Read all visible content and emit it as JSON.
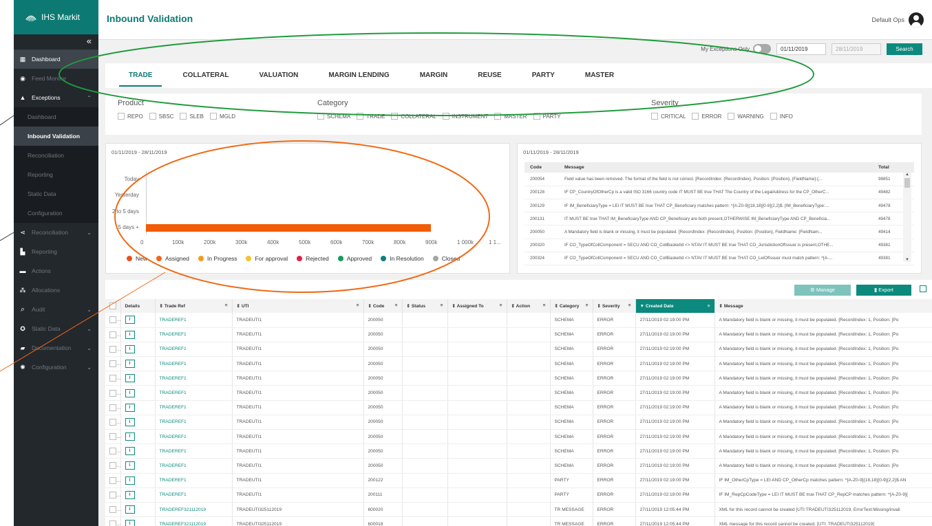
{
  "brand": {
    "name": "IHS Markit"
  },
  "sidebar": {
    "collapse": "«",
    "items": [
      {
        "label": "Dashboard",
        "icon": "dashboard-icon"
      },
      {
        "label": "Feed Monitor",
        "icon": "eye-icon"
      },
      {
        "label": "Exceptions",
        "icon": "warning-icon"
      },
      {
        "label": "Reconciliation",
        "icon": "share-icon"
      },
      {
        "label": "Reporting",
        "icon": "chart-icon"
      },
      {
        "label": "Actions",
        "icon": "briefcase-icon"
      },
      {
        "label": "Allocations",
        "icon": "sitemap-icon"
      },
      {
        "label": "Audit",
        "icon": "search-icon"
      },
      {
        "label": "Static Data",
        "icon": "cog-icon"
      },
      {
        "label": "Documentation",
        "icon": "folder-icon"
      },
      {
        "label": "Configuration",
        "icon": "gear-icon"
      }
    ],
    "exceptions_sub": [
      "Dashboard",
      "Inbound Validation",
      "Reconciliation",
      "Reporting",
      "Static Data",
      "Configuration"
    ]
  },
  "header": {
    "title": "Inbound Validation",
    "user": "Default Ops"
  },
  "filters": {
    "exceptions_only": "My Exceptions Only",
    "date_from": "01/11/2019",
    "date_to": "28/11/2019",
    "search": "Search"
  },
  "tabs": [
    "TRADE",
    "COLLATERAL",
    "VALUATION",
    "MARGIN LENDING",
    "MARGIN",
    "REUSE",
    "PARTY",
    "MASTER"
  ],
  "filter_panel": {
    "product": {
      "label": "Product",
      "options": [
        "REPO",
        "SBSC",
        "SLEB",
        "MGLD"
      ]
    },
    "category": {
      "label": "Category",
      "options": [
        "SCHEMA",
        "TRADE",
        "COLLATERAL",
        "INSTRUMENT",
        "MASTER",
        "PARTY"
      ]
    },
    "severity": {
      "label": "Severity",
      "options": [
        "CRITICAL",
        "ERROR",
        "WARNING",
        "INFO"
      ]
    }
  },
  "age_chart": {
    "range": "01/11/2019 - 28/11/2019"
  },
  "chart_data": {
    "type": "bar",
    "orientation": "horizontal",
    "categories": [
      "Today",
      "Yesterday",
      "2 to 5 days",
      "5 days +"
    ],
    "series": [
      {
        "name": "Assigned",
        "values": [
          0,
          0,
          0,
          900000
        ]
      }
    ],
    "xticks": [
      "0",
      "100k",
      "200k",
      "300k",
      "400k",
      "500k",
      "600k",
      "700k",
      "800k",
      "900k",
      "1 000k",
      "1 1..."
    ],
    "xlim": [
      0,
      1100000
    ],
    "legend": [
      {
        "name": "New",
        "color": "#e9501e"
      },
      {
        "name": "Assigned",
        "color": "#f0661a"
      },
      {
        "name": "In Progress",
        "color": "#f39a1e"
      },
      {
        "name": "For approval",
        "color": "#f6c02e"
      },
      {
        "name": "Rejected",
        "color": "#e21f4b"
      },
      {
        "name": "Approved",
        "color": "#1a9a58"
      },
      {
        "name": "In Resolution",
        "color": "#0d7f80"
      },
      {
        "name": "Closed",
        "color": "#a5a5a5"
      }
    ],
    "legend_position": "bottom",
    "bar_color": "#f25c05"
  },
  "messages": {
    "range": "01/11/2019 - 28/11/2019",
    "headers": [
      "Code",
      "Message",
      "Total"
    ],
    "rows": [
      [
        "200054",
        "Field value has been removed. The format of the field is not correct. [RecordIndex: {RecordIndex}, Position: {Position}, {FieldName}:{...",
        "98851"
      ],
      [
        "200128",
        "IF CP_CountryOfOtherCp is a valid ISO 3166 country code IT MUST BE true THAT The Country of the LegalAddress for the CP_OtherC...",
        "49482"
      ],
      [
        "200129",
        "IF IM_BeneficiaryType = LEI IT MUST BE true THAT CP_Beneficiary matches pattern: ^[A-Z0-9]{18,18}[0-9]{2,2}$. [IM_BeneficiaryType:...",
        "49478"
      ],
      [
        "200131",
        "IT MUST BE true THAT IM_BeneficiaryType AND CP_Beneficiary are both present,OTHERWISE IM_BeneficiaryType AND CP_Beneficia...",
        "49478"
      ],
      [
        "200050",
        "A Mandatory field is blank or missing, it must be populated. [RecordIndex: {RecordIndex}, Position: {Position}, FieldName: {FieldNam...",
        "49414"
      ],
      [
        "200320",
        "IF CO_TypeOfCollComponent = SECU AND CO_CollBasketId <> NTAV IT MUST BE true THAT CO_JurisdictionOfIssuer is present,OTHE...",
        "49381"
      ],
      [
        "200324",
        "IF CO_TypeOfCollComponent = SECU AND CO_CollBasketId <> NTAV IT MUST BE true THAT CO_LeiOfIssuer must match pattern: ^[A-...",
        "49381"
      ]
    ]
  },
  "grid": {
    "manage": "Manage",
    "export": "Export",
    "headers": [
      "Details",
      "Trade Ref",
      "UTI",
      "Code",
      "Status",
      "Assigned To",
      "Action",
      "Category",
      "Severity",
      "Created Date",
      "Message"
    ],
    "rows": [
      [
        "TRADEREF1",
        "TRADEUTI1",
        "200050",
        "",
        "",
        "",
        "SCHEMA",
        "ERROR",
        "27/11/2019 02:19:00 PM",
        "A Mandatory field is blank or missing, it must be populated. [RecordIndex: 1, Position: [Po"
      ],
      [
        "TRADEREF1",
        "TRADEUTI1",
        "200050",
        "",
        "",
        "",
        "SCHEMA",
        "ERROR",
        "27/11/2019 02:19:00 PM",
        "A Mandatory field is blank or missing, it must be populated. [RecordIndex: 1, Position: [Po"
      ],
      [
        "TRADEREF1",
        "TRADEUTI1",
        "200050",
        "",
        "",
        "",
        "SCHEMA",
        "ERROR",
        "27/11/2019 02:19:00 PM",
        "A Mandatory field is blank or missing, it must be populated. [RecordIndex: 1, Position: [Po"
      ],
      [
        "TRADEREF1",
        "TRADEUTI1",
        "200050",
        "",
        "",
        "",
        "SCHEMA",
        "ERROR",
        "27/11/2019 02:19:00 PM",
        "A Mandatory field is blank or missing, it must be populated. [RecordIndex: 1, Position: [Po"
      ],
      [
        "TRADEREF1",
        "TRADEUTI1",
        "200050",
        "",
        "",
        "",
        "SCHEMA",
        "ERROR",
        "27/11/2019 02:19:00 PM",
        "A Mandatory field is blank or missing, it must be populated. [RecordIndex: 1, Position: [Po"
      ],
      [
        "TRADEREF1",
        "TRADEUTI1",
        "200050",
        "",
        "",
        "",
        "SCHEMA",
        "ERROR",
        "27/11/2019 02:19:00 PM",
        "A Mandatory field is blank or missing, it must be populated. [RecordIndex: 1, Position: [Po"
      ],
      [
        "TRADEREF1",
        "TRADEUTI1",
        "200050",
        "",
        "",
        "",
        "SCHEMA",
        "ERROR",
        "27/11/2019 02:19:00 PM",
        "A Mandatory field is blank or missing, it must be populated. [RecordIndex: 1, Position: [Po"
      ],
      [
        "TRADEREF1",
        "TRADEUTI1",
        "200050",
        "",
        "",
        "",
        "SCHEMA",
        "ERROR",
        "27/11/2019 02:19:00 PM",
        "A Mandatory field is blank or missing, it must be populated. [RecordIndex: 1, Position: [Po"
      ],
      [
        "TRADEREF1",
        "TRADEUTI1",
        "200050",
        "",
        "",
        "",
        "SCHEMA",
        "ERROR",
        "27/11/2019 02:19:00 PM",
        "A Mandatory field is blank or missing, it must be populated. [RecordIndex: 1, Position: [Po"
      ],
      [
        "TRADEREF1",
        "TRADEUTI1",
        "200050",
        "",
        "",
        "",
        "SCHEMA",
        "ERROR",
        "27/11/2019 02:19:00 PM",
        "A Mandatory field is blank or missing, it must be populated. [RecordIndex: 1, Position: [Po"
      ],
      [
        "TRADEREF1",
        "TRADEUTI1",
        "200050",
        "",
        "",
        "",
        "SCHEMA",
        "ERROR",
        "27/11/2019 02:19:00 PM",
        "A Mandatory field is blank or missing, it must be populated. [RecordIndex: 1, Position: [Po"
      ],
      [
        "TRADEREF1",
        "TRADEUTI1",
        "200122",
        "",
        "",
        "",
        "PARTY",
        "ERROR",
        "27/11/2019 02:19:00 PM",
        "IF IM_OtherCpType = LEI AND CP_OtherCp matches pattern: ^[A-Z0-9]{18,18}[0-9]{2,2}$ AN"
      ],
      [
        "TRADEREF1",
        "TRADEUTI1",
        "200111",
        "",
        "",
        "",
        "PARTY",
        "ERROR",
        "27/11/2019 02:19:00 PM",
        "IF IM_RepCpCodeType = LEI IT MUST BE true THAT CP_RepCP matches pattern: ^[A-Z0-9]{"
      ],
      [
        "TRADEREF321112019",
        "TRADEUTI325112019",
        "600020",
        "",
        "",
        "",
        "TR MESSAGE",
        "ERROR",
        "27/11/2019 12:05:44 PM",
        "XML for this record cannot be created [UTI:TRADEUTI325112019, ErrorText:Missing/invali"
      ],
      [
        "TRADEREF321112019",
        "TRADEUTI325112019",
        "600018",
        "",
        "",
        "",
        "TR MESSAGE",
        "ERROR",
        "27/11/2019 12:05:44 PM",
        "XML message for this record cannot be created. [UTI: TRADEUTI325112019]"
      ]
    ]
  }
}
